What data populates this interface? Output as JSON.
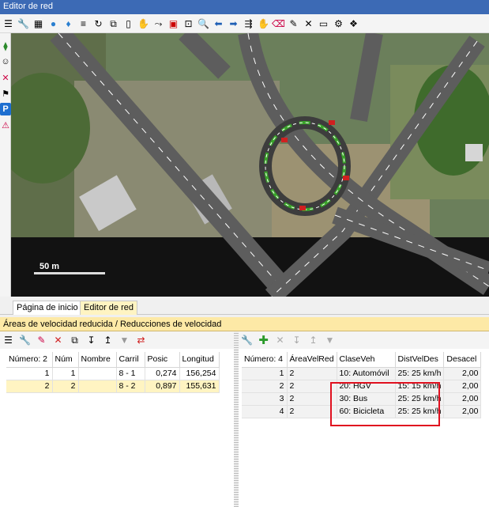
{
  "window": {
    "title": "Editor de red"
  },
  "toolbar": {
    "icons": [
      "list-menu-icon",
      "wrench-icon",
      "grid-icon",
      "globe-icon",
      "pin-icon",
      "list-icon",
      "rotate-icon",
      "copy-icon",
      "doc-icon",
      "hand-select-icon",
      "select-tool-icon",
      "frame-icon",
      "zoom-frame-icon",
      "zoom-icon",
      "back-icon",
      "forward-icon",
      "network-icon",
      "pan-icon",
      "eraser-icon",
      "tool-icon",
      "measure-icon",
      "camera-icon",
      "settings-icon",
      "3d-icon"
    ]
  },
  "sidebar": {
    "icons": [
      "link-icon",
      "pedestrian-icon",
      "connector-icon",
      "signal-icon",
      "parking-icon",
      "crossing-icon"
    ]
  },
  "map": {
    "scale_label": "50 m"
  },
  "tabs": {
    "home": "Página de inicio",
    "network_editor": "Editor de red"
  },
  "list_title": "Áreas de velocidad reducida / Reducciones de velocidad",
  "left_table": {
    "headers": [
      "Número: 2",
      "Núm",
      "Nombre",
      "Carril",
      "Posic",
      "Longitud"
    ],
    "rows": [
      [
        "1",
        "1",
        "",
        "8 - 1",
        "0,274",
        "156,254"
      ],
      [
        "2",
        "2",
        "",
        "8 - 2",
        "0,897",
        "155,631"
      ]
    ]
  },
  "right_table": {
    "headers": [
      "Número: 4",
      "ÁreaVelRed",
      "ClaseVeh",
      "DistVelDes",
      "Desacel"
    ],
    "rows": [
      [
        "1",
        "2",
        "10: Automóvil",
        "25: 25 km/h",
        "2,00"
      ],
      [
        "2",
        "2",
        "20: HGV",
        "15: 15 km/h",
        "2,00"
      ],
      [
        "3",
        "2",
        "30: Bus",
        "25: 25 km/h",
        "2,00"
      ],
      [
        "4",
        "2",
        "60: Bicicleta",
        "25: 25 km/h",
        "2,00"
      ]
    ]
  },
  "colors": {
    "accent": "#3c6ab5",
    "highlight": "#e0101f",
    "selection": "#fff4c2"
  }
}
